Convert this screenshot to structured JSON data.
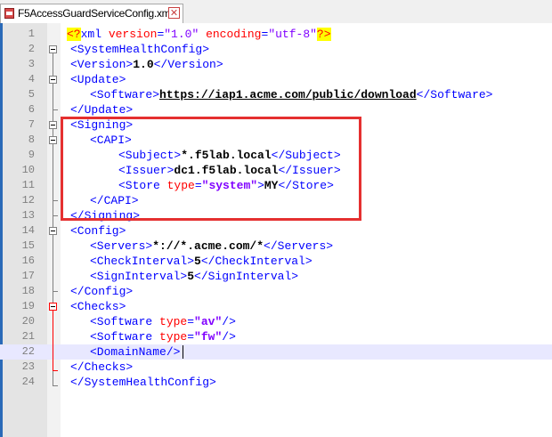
{
  "tab": {
    "filename": "F5AccessGuardServiceConfig.xml",
    "close_icon": "close-icon",
    "close_glyph": "✕"
  },
  "colors": {
    "tag": "#0000ff",
    "attr": "#ff0000",
    "value": "#8000ff",
    "highlight_box": "#e53030",
    "current_line": "#e8e8ff"
  },
  "lines": [
    {
      "num": "1"
    },
    {
      "num": "2"
    },
    {
      "num": "3"
    },
    {
      "num": "4"
    },
    {
      "num": "5"
    },
    {
      "num": "6"
    },
    {
      "num": "7"
    },
    {
      "num": "8"
    },
    {
      "num": "9"
    },
    {
      "num": "10"
    },
    {
      "num": "11"
    },
    {
      "num": "12"
    },
    {
      "num": "13"
    },
    {
      "num": "14"
    },
    {
      "num": "15"
    },
    {
      "num": "16"
    },
    {
      "num": "17"
    },
    {
      "num": "18"
    },
    {
      "num": "19"
    },
    {
      "num": "20"
    },
    {
      "num": "21"
    },
    {
      "num": "22"
    },
    {
      "num": "23"
    },
    {
      "num": "24"
    }
  ],
  "xml": {
    "pi_open": "<?",
    "pi_name": "xml",
    "attr_version": "version",
    "val_version": "\"1.0\"",
    "attr_encoding": "encoding",
    "val_encoding": "\"utf-8\"",
    "pi_close": "?>",
    "system_health_open": "<SystemHealthConfig>",
    "version_open": "<Version>",
    "version_value": "1.0",
    "version_close": "</Version>",
    "update_open": "<Update>",
    "software_open": "<Software>",
    "software_url": "https://iap1.acme.com/public/download",
    "software_close": "</Software>",
    "update_close": "</Update>",
    "signing_open": "<Signing>",
    "capi_open": "<CAPI>",
    "subject_open": "<Subject>",
    "subject_value": "*.f5lab.local",
    "subject_close": "</Subject>",
    "issuer_open": "<Issuer>",
    "issuer_value": "dc1.f5lab.local",
    "issuer_close": "</Issuer>",
    "store_open_start": "<Store ",
    "store_attr": "type",
    "store_attr_val": "\"system\"",
    "store_open_end": ">",
    "store_value": "MY",
    "store_close": "</Store>",
    "capi_close": "</CAPI>",
    "signing_close": "</Signing>",
    "config_open": "<Config>",
    "servers_open": "<Servers>",
    "servers_value": "*://*.acme.com/*",
    "servers_close": "</Servers>",
    "checkinterval_open": "<CheckInterval>",
    "checkinterval_value": "5",
    "checkinterval_close": "</CheckInterval>",
    "signinterval_open": "<SignInterval>",
    "signinterval_value": "5",
    "signinterval_close": "</SignInterval>",
    "config_close": "</Config>",
    "checks_open": "<Checks>",
    "sw_av_start": "<Software ",
    "sw_av_attr": "type",
    "sw_av_val": "\"av\"",
    "sw_av_end": "/>",
    "sw_fw_start": "<Software ",
    "sw_fw_attr": "type",
    "sw_fw_val": "\"fw\"",
    "sw_fw_end": "/>",
    "domainname": "<DomainName/>",
    "checks_close": "</Checks>",
    "system_health_close": "</SystemHealthConfig>",
    "eq": "="
  }
}
